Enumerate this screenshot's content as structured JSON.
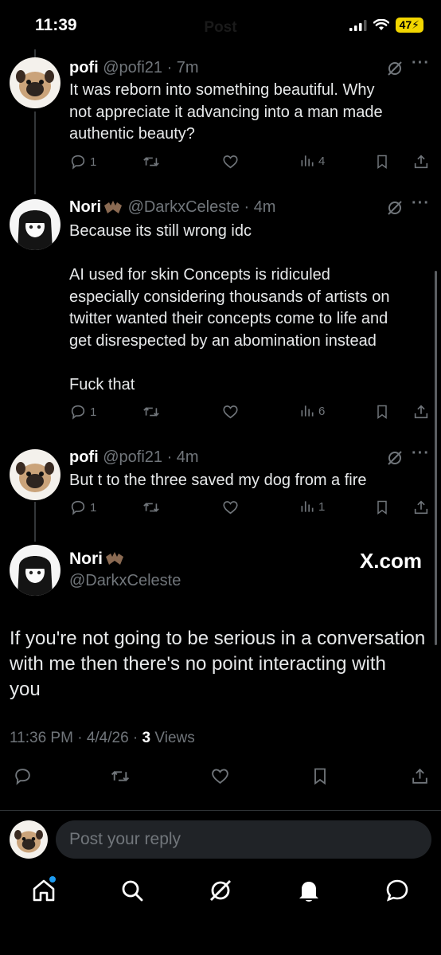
{
  "status_bar": {
    "time": "11:39",
    "title": "Post",
    "battery": "47"
  },
  "thread": [
    {
      "name": "pofi",
      "handle": "@pofi21",
      "time": "7m",
      "lines": [
        "It was reborn into something beautiful. Why",
        "not appreciate it advancing into a man made",
        "authentic beauty?"
      ],
      "replies": "1",
      "views": "4"
    },
    {
      "name": "Nori",
      "handle": "@DarkxCeleste",
      "time": "4m",
      "lines": [
        "Because its still wrong idc",
        "",
        "AI used for skin Concepts is ridiculed",
        "especially considering thousands of artists on",
        "twitter wanted their concepts come to life and",
        "get disrespected by an abomination instead",
        "",
        "Fuck that"
      ],
      "replies": "1",
      "views": "6"
    },
    {
      "name": "pofi",
      "handle": "@pofi21",
      "time": "4m",
      "lines": [
        "But t to the three saved my dog from a fire"
      ],
      "replies": "1",
      "views": "1"
    }
  ],
  "main_post": {
    "name": "Nori",
    "handle": "@DarkxCeleste",
    "watermark": "X.com",
    "lines": [
      "If you're not going to be serious in a conversation",
      "with me then there's no point interacting with",
      "you"
    ],
    "time": "11:36 PM",
    "date": "4/4/26",
    "views_count": "3",
    "views_label": "Views"
  },
  "reply_input": {
    "placeholder": "Post your reply"
  },
  "icons": {
    "reply": "reply-icon",
    "repost": "repost-icon",
    "like": "heart-icon",
    "views": "views-icon",
    "bookmark": "bookmark-icon",
    "share": "share-icon",
    "grok": "grok-icon",
    "more": "more-icon",
    "home": "home-icon",
    "search": "search-icon",
    "notifications": "bell-icon",
    "messages": "messages-icon"
  },
  "colors": {
    "background": "#000000",
    "text": "#e7e9ea",
    "muted": "#71767b",
    "accent": "#1d9bf0",
    "battery": "#f2d600"
  }
}
